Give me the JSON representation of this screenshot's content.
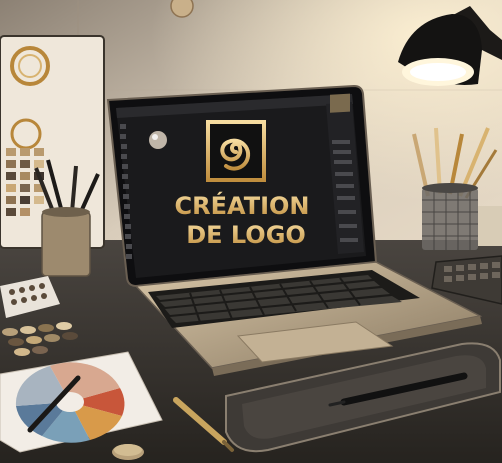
{
  "screen": {
    "logo_line1": "CRÉATION",
    "logo_line2": "DE LOGO"
  },
  "colors": {
    "gold": "#e8c27a",
    "gold_dark": "#b8873a",
    "wall": "#cfc2b0",
    "desk": "#3a3632",
    "laptop_body": "#b9a78e",
    "screen_bg": "#1a1a1c"
  },
  "icons": [
    "spiral-logo-icon",
    "desk-lamp-icon",
    "pencil-cup-icon",
    "drawing-tablet-icon",
    "stylus-icon",
    "color-swatch-card-icon",
    "tool-panel-icon"
  ]
}
